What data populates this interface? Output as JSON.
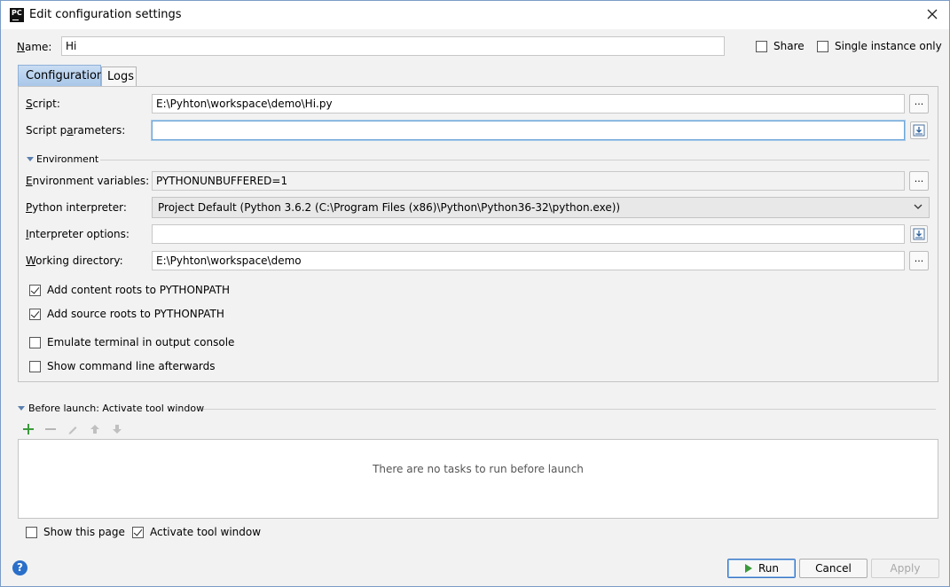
{
  "window": {
    "title": "Edit configuration settings"
  },
  "name_row": {
    "label": "Name:",
    "value": "Hi",
    "share_label": "Share",
    "share_checked": false,
    "single_instance_label": "Single instance only",
    "single_instance_checked": false
  },
  "tabs": [
    {
      "label": "Configuration",
      "active": true
    },
    {
      "label": "Logs",
      "active": false
    }
  ],
  "config": {
    "script_label": "Script:",
    "script_value": "E:\\Pyhton\\workspace\\demo\\Hi.py",
    "script_params_label": "Script parameters:",
    "script_params_value": "",
    "environment_section": "Environment",
    "env_vars_label": "Environment variables:",
    "env_vars_value": "PYTHONUNBUFFERED=1",
    "interpreter_label": "Python interpreter:",
    "interpreter_value": "Project Default (Python 3.6.2 (C:\\Program Files (x86)\\Python\\Python36-32\\python.exe))",
    "interp_options_label": "Interpreter options:",
    "interp_options_value": "",
    "working_dir_label": "Working directory:",
    "working_dir_value": "E:\\Pyhton\\workspace\\demo",
    "checkboxes": [
      {
        "label": "Add content roots to PYTHONPATH",
        "checked": true
      },
      {
        "label": "Add source roots to PYTHONPATH",
        "checked": true
      },
      {
        "label": "Emulate terminal in output console",
        "checked": false
      },
      {
        "label": "Show command line afterwards",
        "checked": false
      }
    ],
    "browse_label": "..."
  },
  "before_launch": {
    "title": "Before launch: Activate tool window",
    "empty_text": "There are no tasks to run before launch",
    "toolbar_icons": [
      "add-icon",
      "remove-icon",
      "edit-icon",
      "move-up-icon",
      "move-down-icon"
    ]
  },
  "footer": {
    "show_page_label": "Show this page",
    "show_page_checked": false,
    "activate_tool_label": "Activate tool window",
    "activate_tool_checked": true,
    "run_label": "Run",
    "cancel_label": "Cancel",
    "apply_label": "Apply"
  },
  "colors": {
    "accent": "#2a6fc9",
    "add_green": "#3a9a3a",
    "run_green": "#3a9a3a"
  }
}
